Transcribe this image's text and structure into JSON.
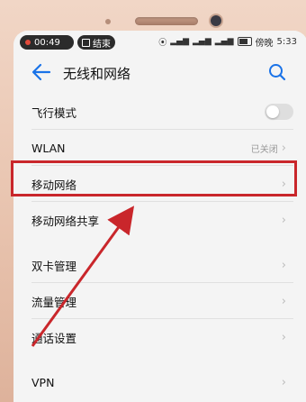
{
  "status_bar": {
    "recording_time": "00:49",
    "end_label": "结束",
    "carrier": "傍晚",
    "clock": "5:33"
  },
  "header": {
    "title": "无线和网络"
  },
  "list": [
    {
      "label": "飞行模式",
      "control": "toggle",
      "toggle_on": false
    },
    {
      "label": "WLAN",
      "value": "已关闭"
    },
    {
      "label": "移动网络"
    },
    {
      "label": "移动网络共享"
    },
    {
      "label": "双卡管理"
    },
    {
      "label": "流量管理"
    },
    {
      "label": "通话设置"
    },
    {
      "label": "VPN"
    }
  ],
  "colors": {
    "accent": "#1a73e8",
    "highlight": "#c9262b",
    "background": "#f4f4f4"
  }
}
